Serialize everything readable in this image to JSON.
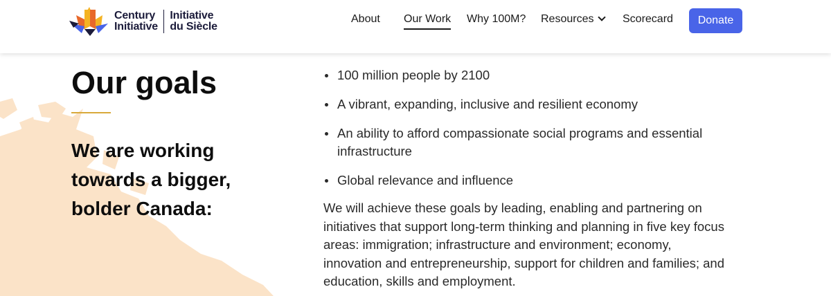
{
  "logo": {
    "line1_en": "Century",
    "line2_en": "Initiative",
    "line1_fr": "Initiative",
    "line2_fr": "du Siècle",
    "colors": [
      "#f4b323",
      "#e8682a",
      "#4964e8",
      "#1b1b3a"
    ]
  },
  "nav": {
    "items": [
      {
        "label": "About"
      },
      {
        "label": "Our Work"
      },
      {
        "label": "Why 100M?"
      },
      {
        "label": "Resources"
      },
      {
        "label": "Scorecard"
      }
    ],
    "active": "Our Work",
    "donate_label": "Donate"
  },
  "hero": {
    "title": "Our goals",
    "subtitle": "We are working towards a bigger, bolder Canada:"
  },
  "goals": [
    "100 million people by 2100",
    "A vibrant, expanding, inclusive and resilient economy",
    "An ability to afford compassionate social programs and essential infrastructure",
    "Global relevance and influence"
  ],
  "paragraph": "We will achieve these goals by leading, enabling and partnering on initiatives that support long-term thinking and planning in five key focus areas: immigration; infrastructure and environment; economy, innovation and entrepreneurship, support for children and families; and education, skills and employment.",
  "colors": {
    "accent": "#4964e8",
    "rule": "#d8a93a",
    "map": "#fbe3c8"
  }
}
